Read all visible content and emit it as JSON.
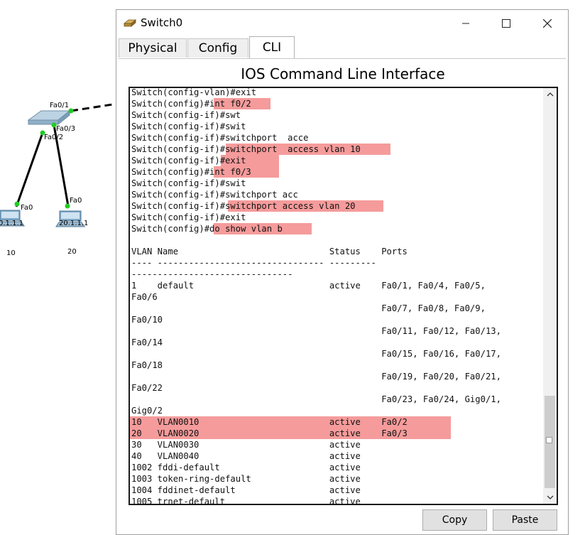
{
  "topology": {
    "labels": {
      "switch_port1": "Fa0/1",
      "switch_port3": "Fa0/3",
      "switch_port2": "Fa0/2",
      "pc1_port": "Fa0",
      "pc2_port": "Fa0",
      "pc1_ip": "0.1.1.1",
      "pc2_ip": "20.1.1.1",
      "pc1_vlan": "10",
      "pc2_vlan": "20"
    },
    "colors": {
      "link": "#000000",
      "port_up": "#22cc22",
      "switch": "#9ab8d0"
    }
  },
  "window": {
    "title": "Switch0",
    "icons": {
      "app": "switch-icon",
      "minimize": "minimize-icon",
      "maximize": "maximize-icon",
      "close": "close-icon"
    },
    "tabs": [
      {
        "label": "Physical",
        "active": false
      },
      {
        "label": "Config",
        "active": false
      },
      {
        "label": "CLI",
        "active": true
      }
    ],
    "heading": "IOS Command Line Interface",
    "copy_label": "Copy",
    "paste_label": "Paste"
  },
  "terminal": {
    "highlight_color": "#f59b9b",
    "lines": [
      "Switch(config-vlan)#exit",
      "Switch(config)#int f0/2",
      "Switch(config-if)#swt",
      "Switch(config-if)#swit",
      "Switch(config-if)#switchport  acce",
      "Switch(config-if)#switchport  access vlan 10",
      "Switch(config-if)#exit",
      "Switch(config)#int f0/3",
      "Switch(config-if)#swit",
      "Switch(config-if)#switchport acc",
      "Switch(config-if)#switchport access vlan 20",
      "Switch(config-if)#exit",
      "Switch(config)#do show vlan b",
      "",
      "VLAN Name                             Status    Ports",
      "---- -------------------------------- --------- ",
      "-------------------------------",
      "1    default                          active    Fa0/1, Fa0/4, Fa0/5,",
      "Fa0/6",
      "                                                Fa0/7, Fa0/8, Fa0/9,",
      "Fa0/10",
      "                                                Fa0/11, Fa0/12, Fa0/13,",
      "Fa0/14",
      "                                                Fa0/15, Fa0/16, Fa0/17,",
      "Fa0/18",
      "                                                Fa0/19, Fa0/20, Fa0/21,",
      "Fa0/22",
      "                                                Fa0/23, Fa0/24, Gig0/1,",
      "Gig0/2",
      "10   VLAN0010                         active    Fa0/2",
      "20   VLAN0020                         active    Fa0/3",
      "30   VLAN0030                         active",
      "40   VLAN0040                         active",
      "1002 fddi-default                     active",
      "1003 token-ring-default               active",
      "1004 fddinet-default                  active",
      "1005 trnet-default                    active"
    ],
    "scroll_icons": {
      "up": "chevron-up-icon",
      "down": "chevron-down-icon"
    }
  }
}
